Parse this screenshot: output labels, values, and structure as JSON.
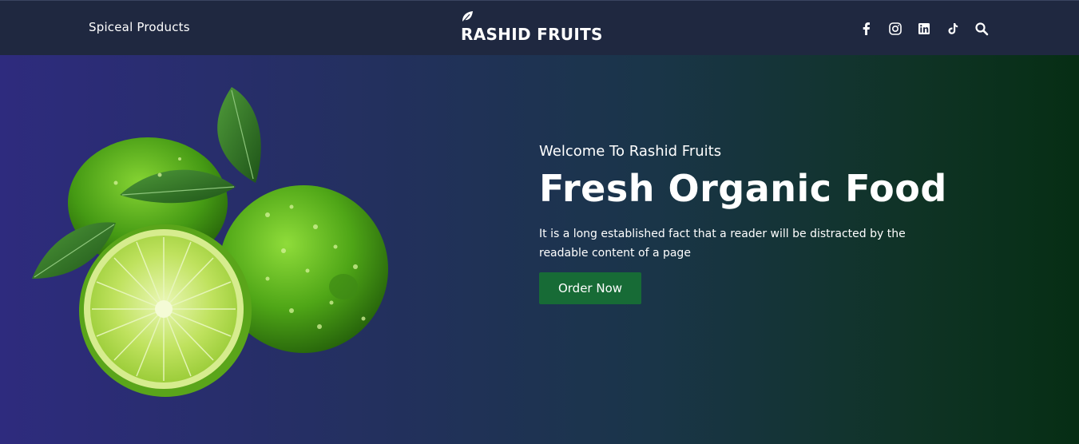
{
  "nav": {
    "link_label": "Spiceal Products",
    "brand_name": "RASHID FRUITS",
    "icons": [
      "facebook-icon",
      "instagram-icon",
      "linkedin-icon",
      "tiktok-icon",
      "search-icon"
    ]
  },
  "hero": {
    "welcome": "Welcome To Rashid Fruits",
    "headline": "Fresh Organic Food",
    "description": "It is a long established fact that a reader will be distracted by the readable content of a page",
    "button_label": "Order Now"
  },
  "colors": {
    "navbar_bg": "#1f2840",
    "hero_gradient_start": "#2e2b7e",
    "hero_gradient_end": "#062e14",
    "button_bg": "#176b36",
    "lime_green": "#6cc51e"
  }
}
